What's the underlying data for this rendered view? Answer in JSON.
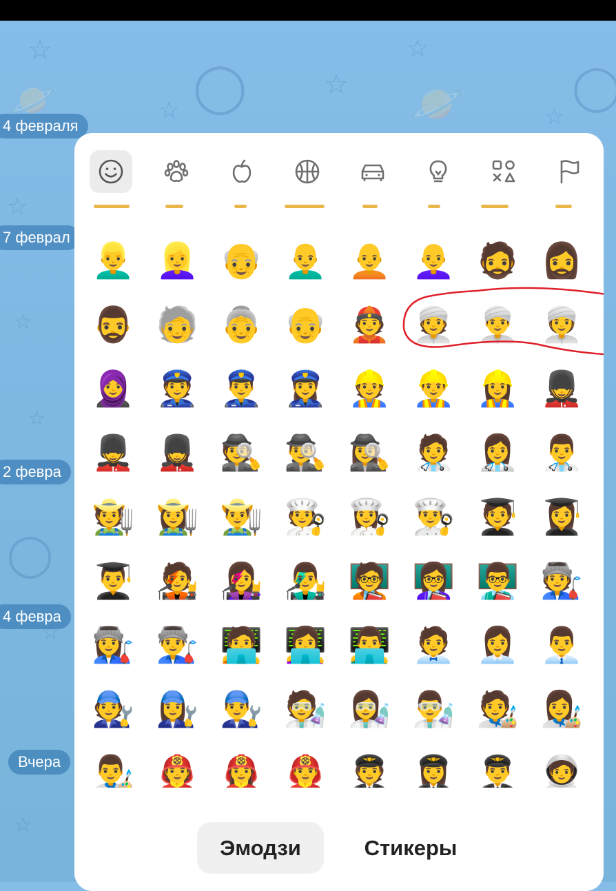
{
  "colors": {
    "wallpaper": "#82bbe6",
    "panel": "#ffffff",
    "active_tab_bg": "#f0f0f0",
    "category_icon": "#6e6e6e",
    "annotation": "#e0202a",
    "date_pill": "#4a86b8"
  },
  "chat_dates": [
    "4 февраля",
    "7 феврал",
    "2 февра",
    "4 февра",
    "Вчера"
  ],
  "categories": [
    {
      "name": "smileys",
      "icon": "smiley-icon",
      "active": true
    },
    {
      "name": "animals",
      "icon": "paw-icon",
      "active": false
    },
    {
      "name": "food",
      "icon": "apple-icon",
      "active": false
    },
    {
      "name": "activity",
      "icon": "ball-icon",
      "active": false
    },
    {
      "name": "travel",
      "icon": "car-icon",
      "active": false
    },
    {
      "name": "objects",
      "icon": "lightbulb-icon",
      "active": false
    },
    {
      "name": "symbols",
      "icon": "symbols-icon",
      "active": false
    },
    {
      "name": "flags",
      "icon": "flag-icon",
      "active": false
    }
  ],
  "emoji_rows": [
    [
      "👱‍♂️",
      "👱‍♀️",
      "👴",
      "👨‍🦲",
      "🧑‍🦲",
      "👩‍🦲",
      "🧔",
      "🧔‍♀️"
    ],
    [
      "🧔‍♂️",
      "🧓",
      "👵",
      "👴",
      "👲",
      "👳",
      "👳‍♂️",
      "👳‍♀️"
    ],
    [
      "🧕",
      "👮",
      "👮‍♂️",
      "👮‍♀️",
      "👷",
      "👷‍♂️",
      "👷‍♀️",
      "💂"
    ],
    [
      "💂‍♂️",
      "💂‍♀️",
      "🕵️",
      "🕵️‍♂️",
      "🕵️‍♀️",
      "🧑‍⚕️",
      "👩‍⚕️",
      "👨‍⚕️"
    ],
    [
      "🧑‍🌾",
      "👩‍🌾",
      "👨‍🌾",
      "🧑‍🍳",
      "👩‍🍳",
      "👨‍🍳",
      "🧑‍🎓",
      "👩‍🎓"
    ],
    [
      "👨‍🎓",
      "🧑‍🎤",
      "👩‍🎤",
      "👨‍🎤",
      "🧑‍🏫",
      "👩‍🏫",
      "👨‍🏫",
      "🧑‍🏭"
    ],
    [
      "👩‍🏭",
      "👨‍🏭",
      "🧑‍💻",
      "👩‍💻",
      "👨‍💻",
      "🧑‍💼",
      "👩‍💼",
      "👨‍💼"
    ],
    [
      "🧑‍🔧",
      "👩‍🔧",
      "👨‍🔧",
      "🧑‍🔬",
      "👩‍🔬",
      "👨‍🔬",
      "🧑‍🎨",
      "👩‍🎨"
    ],
    [
      "👨‍🎨",
      "🧑‍🚒",
      "👩‍🚒",
      "👨‍🚒",
      "🧑‍✈️",
      "👩‍✈️",
      "👨‍✈️",
      "🧑‍🚀"
    ]
  ],
  "tabs": {
    "emoji": "Эмодзи",
    "stickers": "Стикеры"
  }
}
